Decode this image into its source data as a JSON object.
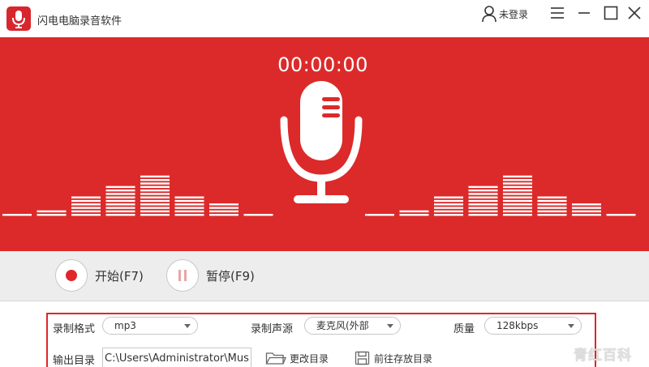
{
  "app": {
    "title": "闪电电脑录音软件",
    "brand_color": "#dc2a2a"
  },
  "titlebar": {
    "user_label": "未登录",
    "icons": [
      "user-icon",
      "menu-icon",
      "minimize-icon",
      "maximize-icon",
      "close-icon"
    ]
  },
  "recording": {
    "timer": "00:00:00",
    "visualizer_levels": [
      1,
      2,
      6,
      9,
      12,
      6,
      4,
      1,
      1,
      2,
      6,
      9,
      12,
      6,
      4,
      1
    ]
  },
  "controls": {
    "start_label": "开始(F7)",
    "pause_label": "暂停(F9)"
  },
  "settings": {
    "format_label": "录制格式",
    "format_value": "mp3",
    "source_label": "录制声源",
    "source_value": "麦克风(外部",
    "quality_label": "质量",
    "quality_value": "128kbps",
    "output_label": "输出目录",
    "output_path": "C:\\Users\\Administrator\\Music",
    "change_dir_label": "更改目录",
    "open_dir_label": "前往存放目录"
  },
  "watermark": {
    "text": "青红百科"
  }
}
